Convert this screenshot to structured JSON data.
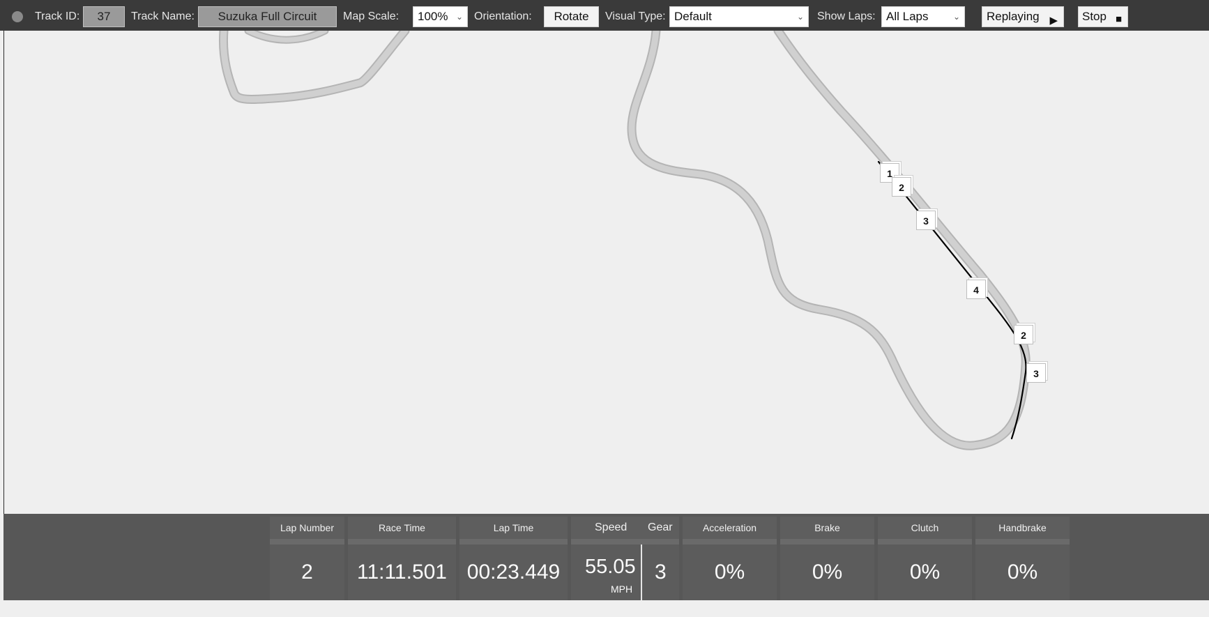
{
  "toolbar": {
    "track_id_label": "Track ID:",
    "track_id_value": "37",
    "track_name_label": "Track Name:",
    "track_name_value": "Suzuka Full Circuit",
    "map_scale_label": "Map Scale:",
    "map_scale_value": "100%",
    "orientation_label": "Orientation:",
    "rotate_button": "Rotate",
    "visual_type_label": "Visual Type:",
    "visual_type_value": "Default",
    "show_laps_label": "Show Laps:",
    "show_laps_value": "All Laps",
    "replaying_button": "Replaying",
    "stop_button": "Stop"
  },
  "map": {
    "markers": [
      "1",
      "2",
      "3",
      "4",
      "2",
      "3"
    ]
  },
  "telemetry": {
    "lap_number_label": "Lap Number",
    "lap_number_value": "2",
    "race_time_label": "Race Time",
    "race_time_value": "11:11.501",
    "lap_time_label": "Lap Time",
    "lap_time_value": "00:23.449",
    "speed_label": "Speed",
    "speed_value": "55.05",
    "speed_unit": "MPH",
    "gear_label": "Gear",
    "gear_value": "3",
    "acceleration_label": "Acceleration",
    "acceleration_value": "0%",
    "brake_label": "Brake",
    "brake_value": "0%",
    "clutch_label": "Clutch",
    "clutch_value": "0%",
    "handbrake_label": "Handbrake",
    "handbrake_value": "0%"
  },
  "colors": {
    "toolbar_bg": "#3a3a3a",
    "map_bg": "#efefef",
    "track": "#c8c8c8",
    "racing_line": "#000000",
    "bottom_bg": "#575757"
  },
  "icons": {
    "status": "status-dot-icon",
    "play": "play-icon",
    "stop": "stop-icon",
    "dropdown": "chevron-down-icon"
  }
}
